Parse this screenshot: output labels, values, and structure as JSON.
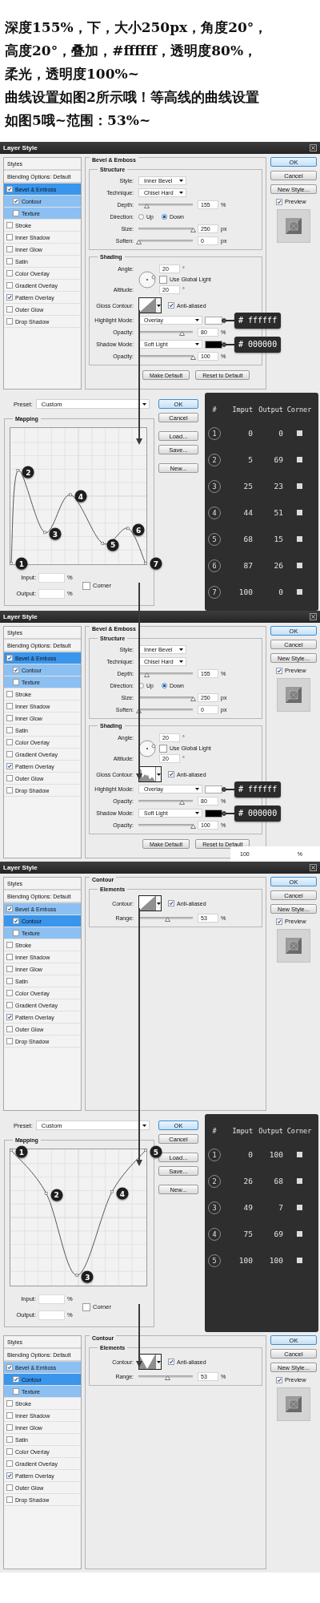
{
  "intro_lines": [
    "深度155%，下，大小250px，角度20°，",
    "高度20°，叠加，#ffffff，透明度80%，",
    "柔光，透明度100%~",
    "曲线设置如图2所示哦！等高线的曲线设置",
    "如图5哦~范围：53%~"
  ],
  "panels": [
    {
      "kind": "layer_style",
      "title": "Layer Style",
      "styles_header": "Styles",
      "blending_label": "Blending Options: Default",
      "style_items": [
        {
          "label": "Bevel & Emboss",
          "checked": true,
          "selected": true,
          "children": [
            {
              "label": "Contour",
              "checked": true,
              "selected": false
            },
            {
              "label": "Texture",
              "checked": false,
              "selected": false
            }
          ]
        },
        {
          "label": "Stroke",
          "checked": false,
          "selected": false
        },
        {
          "label": "Inner Shadow",
          "checked": false,
          "selected": false
        },
        {
          "label": "Inner Glow",
          "checked": false,
          "selected": false
        },
        {
          "label": "Satin",
          "checked": false,
          "selected": false
        },
        {
          "label": "Color Overlay",
          "checked": false,
          "selected": false
        },
        {
          "label": "Gradient Overlay",
          "checked": false,
          "selected": false
        },
        {
          "label": "Pattern Overlay",
          "checked": true,
          "selected": false
        },
        {
          "label": "Outer Glow",
          "checked": false,
          "selected": false
        },
        {
          "label": "Drop Shadow",
          "checked": false,
          "selected": false
        }
      ],
      "settings": {
        "kind": "bevel",
        "title": "Bevel & Emboss",
        "groups": [
          {
            "title": "Structure",
            "rows": [
              {
                "kind": "select",
                "label": "Style:",
                "value": "Inner Bevel"
              },
              {
                "kind": "select",
                "label": "Technique:",
                "value": "Chisel Hard"
              },
              {
                "kind": "slider",
                "label": "Depth:",
                "level": 0.15,
                "value": "155",
                "unit": "%"
              },
              {
                "kind": "radio",
                "label": "Direction:",
                "options": [
                  {
                    "label": "Up",
                    "selected": false
                  },
                  {
                    "label": "Down",
                    "selected": true
                  }
                ]
              },
              {
                "kind": "slider",
                "label": "Size:",
                "level": 1,
                "value": "250",
                "unit": "px"
              },
              {
                "kind": "slider",
                "label": "Soften:",
                "level": 0,
                "value": "0",
                "unit": "px"
              }
            ]
          },
          {
            "title": "Shading",
            "rows": [
              {
                "kind": "angle",
                "label": "Angle:",
                "value": "20",
                "unit": "°",
                "global_light": {
                  "label": "Use Global Light",
                  "checked": false
                },
                "altitude_label": "Altitude:",
                "altitude": "20",
                "altitude_unit": "°"
              },
              {
                "kind": "contour",
                "label": "Gloss Contour:",
                "shape": {
                  "kind": "linear"
                },
                "anti_aliased": {
                  "label": "Anti-aliased",
                  "checked": true
                }
              },
              {
                "kind": "mode",
                "label": "Highlight Mode:",
                "value": "Overlay",
                "color": "#ffffff",
                "callout": "# ffffff"
              },
              {
                "kind": "slider",
                "label": "Opacity:",
                "level": 0.8,
                "value": "80",
                "unit": "%"
              },
              {
                "kind": "mode",
                "label": "Shadow Mode:",
                "value": "Soft Light",
                "color": "#000000",
                "callout": "# 000000"
              },
              {
                "kind": "slider",
                "label": "Opacity:",
                "level": 1,
                "value": "100",
                "unit": "%"
              }
            ]
          }
        ],
        "footer_buttons": [
          "Make Default",
          "Reset to Default"
        ]
      },
      "buttons": [
        {
          "label": "OK",
          "default": true
        },
        {
          "label": "Cancel",
          "default": false
        },
        {
          "label": "New Style...",
          "default": false
        }
      ],
      "preview": {
        "label": "Preview",
        "checked": true
      }
    },
    {
      "kind": "contour_editor",
      "preset_label": "Preset:",
      "preset": "Custom",
      "mapping_title": "Mapping",
      "graph_markers": [
        "1",
        "2",
        "3",
        "4",
        "5",
        "6",
        "7"
      ],
      "input_label": "Input:",
      "input_unit": "%",
      "output_label": "Output:",
      "output_unit": "%",
      "corner": {
        "label": "Corner",
        "checked": false
      },
      "buttons": [
        {
          "label": "OK",
          "default": true
        },
        {
          "label": "Cancel",
          "default": false
        },
        {
          "label": "Load...",
          "default": false
        },
        {
          "label": "Save...",
          "default": false
        },
        {
          "label": "New...",
          "default": false
        }
      ],
      "table": {
        "columns": [
          "#",
          "Imput",
          "Output",
          "Corner"
        ],
        "rows": [
          {
            "number": "1",
            "input": "0",
            "output": "0",
            "corner": false
          },
          {
            "number": "2",
            "input": "5",
            "output": "69",
            "corner": false
          },
          {
            "number": "3",
            "input": "25",
            "output": "23",
            "corner": false
          },
          {
            "number": "4",
            "input": "44",
            "output": "51",
            "corner": false
          },
          {
            "number": "5",
            "input": "68",
            "output": "15",
            "corner": false
          },
          {
            "number": "6",
            "input": "87",
            "output": "26",
            "corner": false
          },
          {
            "number": "7",
            "input": "100",
            "output": "0",
            "corner": false
          }
        ]
      }
    },
    {
      "kind": "layer_style",
      "title": "Layer Style",
      "styles_header": "Styles",
      "blending_label": "Blending Options: Default",
      "style_items": [
        {
          "label": "Bevel & Emboss",
          "checked": true,
          "selected": true,
          "children": [
            {
              "label": "Contour",
              "checked": true,
              "selected": false
            },
            {
              "label": "Texture",
              "checked": false,
              "selected": false
            }
          ]
        },
        {
          "label": "Stroke",
          "checked": false,
          "selected": false
        },
        {
          "label": "Inner Shadow",
          "checked": false,
          "selected": false
        },
        {
          "label": "Inner Glow",
          "checked": false,
          "selected": false
        },
        {
          "label": "Satin",
          "checked": false,
          "selected": false
        },
        {
          "label": "Color Overlay",
          "checked": false,
          "selected": false
        },
        {
          "label": "Gradient Overlay",
          "checked": false,
          "selected": false
        },
        {
          "label": "Pattern Overlay",
          "checked": true,
          "selected": false
        },
        {
          "label": "Outer Glow",
          "checked": false,
          "selected": false
        },
        {
          "label": "Drop Shadow",
          "checked": false,
          "selected": false
        }
      ],
      "settings": {
        "kind": "bevel",
        "title": "Bevel & Emboss",
        "groups": [
          {
            "title": "Structure",
            "rows": [
              {
                "kind": "select",
                "label": "Style:",
                "value": "Inner Bevel"
              },
              {
                "kind": "select",
                "label": "Technique:",
                "value": "Chisel Hard"
              },
              {
                "kind": "slider",
                "label": "Depth:",
                "level": 0.15,
                "value": "155",
                "unit": "%"
              },
              {
                "kind": "radio",
                "label": "Direction:",
                "options": [
                  {
                    "label": "Up",
                    "selected": false
                  },
                  {
                    "label": "Down",
                    "selected": true
                  }
                ]
              },
              {
                "kind": "slider",
                "label": "Size:",
                "level": 1,
                "value": "250",
                "unit": "px"
              },
              {
                "kind": "slider",
                "label": "Soften:",
                "level": 0,
                "value": "0",
                "unit": "px"
              }
            ]
          },
          {
            "title": "Shading",
            "rows": [
              {
                "kind": "angle",
                "label": "Angle:",
                "value": "20",
                "unit": "°",
                "global_light": {
                  "label": "Use Global Light",
                  "checked": false
                },
                "altitude_label": "Altitude:",
                "altitude": "20",
                "altitude_unit": "°"
              },
              {
                "kind": "contour",
                "label": "Gloss Contour:",
                "shape": {
                  "kind": "wave"
                },
                "anti_aliased": {
                  "label": "Anti-aliased",
                  "checked": true
                }
              },
              {
                "kind": "mode",
                "label": "Highlight Mode:",
                "value": "Overlay",
                "color": "#ffffff",
                "callout": "# ffffff"
              },
              {
                "kind": "slider",
                "label": "Opacity:",
                "level": 0.8,
                "value": "80",
                "unit": "%"
              },
              {
                "kind": "mode",
                "label": "Shadow Mode:",
                "value": "Soft Light",
                "color": "#000000",
                "callout": "# 000000"
              },
              {
                "kind": "slider",
                "label": "Opacity:",
                "level": 1,
                "value": "100",
                "unit": "%"
              }
            ]
          }
        ],
        "footer_buttons": [
          "Make Default",
          "Reset to Default"
        ]
      },
      "buttons": [
        {
          "label": "OK",
          "default": true
        },
        {
          "label": "Cancel",
          "default": false
        },
        {
          "label": "New Style...",
          "default": false
        }
      ],
      "preview": {
        "label": "Preview",
        "checked": true
      },
      "overlay_fragment": {
        "value": "100",
        "unit": "%"
      }
    },
    {
      "kind": "layer_style",
      "title": "Layer Style",
      "styles_header": "Styles",
      "blending_label": "Blending Options: Default",
      "style_items": [
        {
          "label": "Bevel & Emboss",
          "checked": true,
          "selected": false,
          "children": [
            {
              "label": "Contour",
              "checked": true,
              "selected": true
            },
            {
              "label": "Texture",
              "checked": false,
              "selected": false
            }
          ]
        },
        {
          "label": "Stroke",
          "checked": false,
          "selected": false
        },
        {
          "label": "Inner Shadow",
          "checked": false,
          "selected": false
        },
        {
          "label": "Inner Glow",
          "checked": false,
          "selected": false
        },
        {
          "label": "Satin",
          "checked": false,
          "selected": false
        },
        {
          "label": "Color Overlay",
          "checked": false,
          "selected": false
        },
        {
          "label": "Gradient Overlay",
          "checked": false,
          "selected": false
        },
        {
          "label": "Pattern Overlay",
          "checked": true,
          "selected": false
        },
        {
          "label": "Outer Glow",
          "checked": false,
          "selected": false
        },
        {
          "label": "Drop Shadow",
          "checked": false,
          "selected": false
        }
      ],
      "settings": {
        "kind": "contour",
        "title": "Contour",
        "groups": [
          {
            "title": "Elements",
            "rows": [
              {
                "kind": "contour",
                "label": "Contour:",
                "shape": {
                  "kind": "linear"
                },
                "anti_aliased": {
                  "label": "Anti-aliased",
                  "checked": true
                }
              },
              {
                "kind": "slider",
                "label": "Range:",
                "level": 0.53,
                "value": "53",
                "unit": "%"
              }
            ]
          }
        ]
      },
      "buttons": [
        {
          "label": "OK",
          "default": true
        },
        {
          "label": "Cancel",
          "default": false
        },
        {
          "label": "New Style...",
          "default": false
        }
      ],
      "preview": {
        "label": "Preview",
        "checked": true
      }
    },
    {
      "kind": "contour_editor",
      "preset_label": "Preset:",
      "preset": "Custom",
      "mapping_title": "Mapping",
      "graph_markers": [
        "1",
        "2",
        "3",
        "4",
        "5"
      ],
      "input_label": "Input:",
      "input_unit": "%",
      "output_label": "Output:",
      "output_unit": "%",
      "corner": {
        "label": "Corner",
        "checked": false
      },
      "buttons": [
        {
          "label": "OK",
          "default": true
        },
        {
          "label": "Cancel",
          "default": false
        },
        {
          "label": "Load...",
          "default": false
        },
        {
          "label": "Save...",
          "default": false
        },
        {
          "label": "New...",
          "default": false
        }
      ],
      "table": {
        "columns": [
          "#",
          "Imput",
          "Output",
          "Corner"
        ],
        "rows": [
          {
            "number": "1",
            "input": "0",
            "output": "100",
            "corner": false
          },
          {
            "number": "2",
            "input": "26",
            "output": "68",
            "corner": false
          },
          {
            "number": "3",
            "input": "49",
            "output": "7",
            "corner": false
          },
          {
            "number": "4",
            "input": "75",
            "output": "69",
            "corner": false
          },
          {
            "number": "5",
            "input": "100",
            "output": "100",
            "corner": false
          }
        ]
      }
    },
    {
      "kind": "layer_style",
      "styles_header": "Styles",
      "blending_label": "Blending Options: Default",
      "style_items": [
        {
          "label": "Bevel & Emboss",
          "checked": true,
          "selected": false,
          "children": [
            {
              "label": "Contour",
              "checked": true,
              "selected": true
            },
            {
              "label": "Texture",
              "checked": false,
              "selected": false
            }
          ]
        },
        {
          "label": "Stroke",
          "checked": false,
          "selected": false
        },
        {
          "label": "Inner Shadow",
          "checked": false,
          "selected": false
        },
        {
          "label": "Inner Glow",
          "checked": false,
          "selected": false
        },
        {
          "label": "Satin",
          "checked": false,
          "selected": false
        },
        {
          "label": "Color Overlay",
          "checked": false,
          "selected": false
        },
        {
          "label": "Gradient Overlay",
          "checked": false,
          "selected": false
        },
        {
          "label": "Pattern Overlay",
          "checked": true,
          "selected": false
        },
        {
          "label": "Outer Glow",
          "checked": false,
          "selected": false
        },
        {
          "label": "Drop Shadow",
          "checked": false,
          "selected": false
        }
      ],
      "settings": {
        "kind": "contour",
        "title": "Contour",
        "groups": [
          {
            "title": "Elements",
            "rows": [
              {
                "kind": "contour",
                "label": "Contour:",
                "shape": {
                  "kind": "cone"
                },
                "anti_aliased": {
                  "label": "Anti-aliased",
                  "checked": true
                }
              },
              {
                "kind": "slider",
                "label": "Range:",
                "level": 0.53,
                "value": "53",
                "unit": "%"
              }
            ]
          }
        ]
      },
      "buttons": [
        {
          "label": "OK",
          "default": true
        },
        {
          "label": "Cancel",
          "default": false
        },
        {
          "label": "New Style...",
          "default": false
        }
      ],
      "preview": {
        "label": "Preview",
        "checked": true
      }
    }
  ]
}
